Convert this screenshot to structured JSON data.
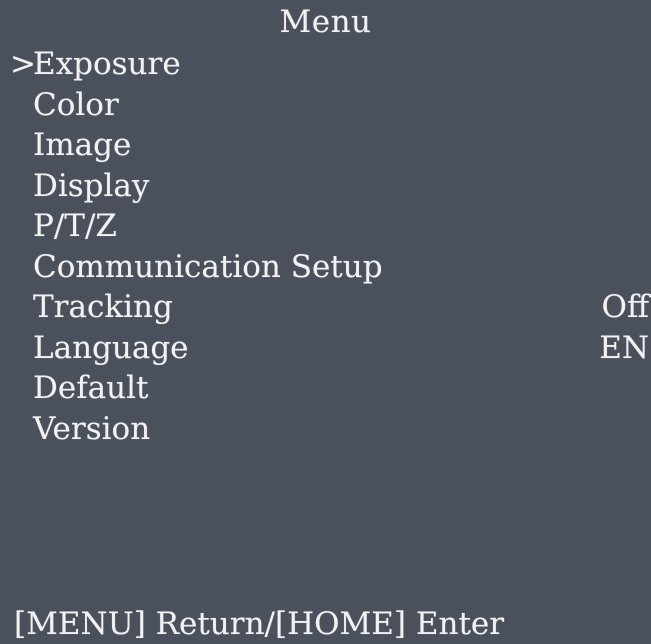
{
  "menu": {
    "title": "Menu",
    "cursor": ">",
    "items": [
      {
        "label": "Exposure",
        "value": "",
        "selected": true
      },
      {
        "label": "Color",
        "value": "",
        "selected": false
      },
      {
        "label": "Image",
        "value": "",
        "selected": false
      },
      {
        "label": "Display",
        "value": "",
        "selected": false
      },
      {
        "label": "P/T/Z",
        "value": "",
        "selected": false
      },
      {
        "label": "Communication Setup",
        "value": "",
        "selected": false
      },
      {
        "label": "Tracking",
        "value": "Off",
        "selected": false
      },
      {
        "label": "Language",
        "value": "EN",
        "selected": false
      },
      {
        "label": "Default",
        "value": "",
        "selected": false
      },
      {
        "label": "Version",
        "value": "",
        "selected": false
      }
    ]
  },
  "footer": {
    "hint": "[MENU] Return/[HOME] Enter"
  },
  "colors": {
    "background": "#4b505d",
    "text": "#f2f2f2"
  }
}
